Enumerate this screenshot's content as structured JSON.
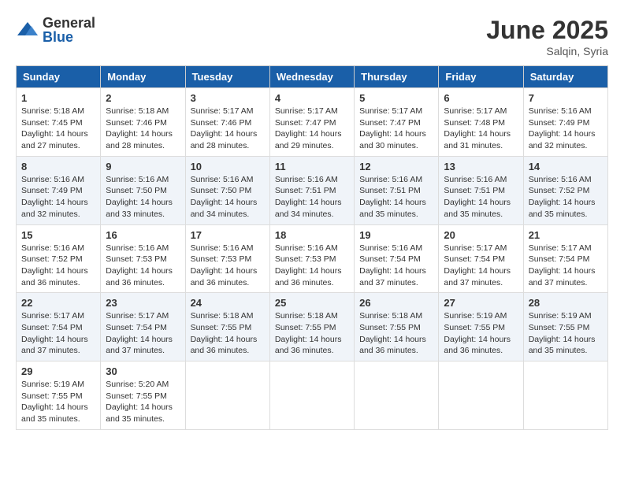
{
  "logo": {
    "general": "General",
    "blue": "Blue"
  },
  "title": "June 2025",
  "location": "Salqin, Syria",
  "headers": [
    "Sunday",
    "Monday",
    "Tuesday",
    "Wednesday",
    "Thursday",
    "Friday",
    "Saturday"
  ],
  "weeks": [
    [
      {
        "day": "1",
        "sunrise": "5:18 AM",
        "sunset": "7:45 PM",
        "daylight": "14 hours and 27 minutes."
      },
      {
        "day": "2",
        "sunrise": "5:18 AM",
        "sunset": "7:46 PM",
        "daylight": "14 hours and 28 minutes."
      },
      {
        "day": "3",
        "sunrise": "5:17 AM",
        "sunset": "7:46 PM",
        "daylight": "14 hours and 28 minutes."
      },
      {
        "day": "4",
        "sunrise": "5:17 AM",
        "sunset": "7:47 PM",
        "daylight": "14 hours and 29 minutes."
      },
      {
        "day": "5",
        "sunrise": "5:17 AM",
        "sunset": "7:47 PM",
        "daylight": "14 hours and 30 minutes."
      },
      {
        "day": "6",
        "sunrise": "5:17 AM",
        "sunset": "7:48 PM",
        "daylight": "14 hours and 31 minutes."
      },
      {
        "day": "7",
        "sunrise": "5:16 AM",
        "sunset": "7:49 PM",
        "daylight": "14 hours and 32 minutes."
      }
    ],
    [
      {
        "day": "8",
        "sunrise": "5:16 AM",
        "sunset": "7:49 PM",
        "daylight": "14 hours and 32 minutes."
      },
      {
        "day": "9",
        "sunrise": "5:16 AM",
        "sunset": "7:50 PM",
        "daylight": "14 hours and 33 minutes."
      },
      {
        "day": "10",
        "sunrise": "5:16 AM",
        "sunset": "7:50 PM",
        "daylight": "14 hours and 34 minutes."
      },
      {
        "day": "11",
        "sunrise": "5:16 AM",
        "sunset": "7:51 PM",
        "daylight": "14 hours and 34 minutes."
      },
      {
        "day": "12",
        "sunrise": "5:16 AM",
        "sunset": "7:51 PM",
        "daylight": "14 hours and 35 minutes."
      },
      {
        "day": "13",
        "sunrise": "5:16 AM",
        "sunset": "7:51 PM",
        "daylight": "14 hours and 35 minutes."
      },
      {
        "day": "14",
        "sunrise": "5:16 AM",
        "sunset": "7:52 PM",
        "daylight": "14 hours and 35 minutes."
      }
    ],
    [
      {
        "day": "15",
        "sunrise": "5:16 AM",
        "sunset": "7:52 PM",
        "daylight": "14 hours and 36 minutes."
      },
      {
        "day": "16",
        "sunrise": "5:16 AM",
        "sunset": "7:53 PM",
        "daylight": "14 hours and 36 minutes."
      },
      {
        "day": "17",
        "sunrise": "5:16 AM",
        "sunset": "7:53 PM",
        "daylight": "14 hours and 36 minutes."
      },
      {
        "day": "18",
        "sunrise": "5:16 AM",
        "sunset": "7:53 PM",
        "daylight": "14 hours and 36 minutes."
      },
      {
        "day": "19",
        "sunrise": "5:16 AM",
        "sunset": "7:54 PM",
        "daylight": "14 hours and 37 minutes."
      },
      {
        "day": "20",
        "sunrise": "5:17 AM",
        "sunset": "7:54 PM",
        "daylight": "14 hours and 37 minutes."
      },
      {
        "day": "21",
        "sunrise": "5:17 AM",
        "sunset": "7:54 PM",
        "daylight": "14 hours and 37 minutes."
      }
    ],
    [
      {
        "day": "22",
        "sunrise": "5:17 AM",
        "sunset": "7:54 PM",
        "daylight": "14 hours and 37 minutes."
      },
      {
        "day": "23",
        "sunrise": "5:17 AM",
        "sunset": "7:54 PM",
        "daylight": "14 hours and 37 minutes."
      },
      {
        "day": "24",
        "sunrise": "5:18 AM",
        "sunset": "7:55 PM",
        "daylight": "14 hours and 36 minutes."
      },
      {
        "day": "25",
        "sunrise": "5:18 AM",
        "sunset": "7:55 PM",
        "daylight": "14 hours and 36 minutes."
      },
      {
        "day": "26",
        "sunrise": "5:18 AM",
        "sunset": "7:55 PM",
        "daylight": "14 hours and 36 minutes."
      },
      {
        "day": "27",
        "sunrise": "5:19 AM",
        "sunset": "7:55 PM",
        "daylight": "14 hours and 36 minutes."
      },
      {
        "day": "28",
        "sunrise": "5:19 AM",
        "sunset": "7:55 PM",
        "daylight": "14 hours and 35 minutes."
      }
    ],
    [
      {
        "day": "29",
        "sunrise": "5:19 AM",
        "sunset": "7:55 PM",
        "daylight": "14 hours and 35 minutes."
      },
      {
        "day": "30",
        "sunrise": "5:20 AM",
        "sunset": "7:55 PM",
        "daylight": "14 hours and 35 minutes."
      },
      null,
      null,
      null,
      null,
      null
    ]
  ]
}
